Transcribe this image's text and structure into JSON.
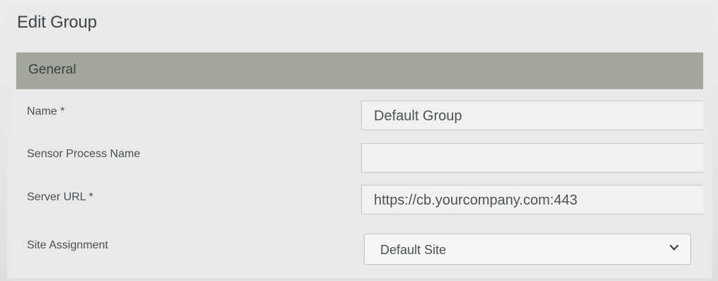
{
  "window": {
    "title": "Edit Group"
  },
  "section": {
    "title": "General"
  },
  "fields": {
    "name": {
      "label": "Name *",
      "value": "Default Group"
    },
    "sensor_process_name": {
      "label": "Sensor Process Name",
      "value": ""
    },
    "server_url": {
      "label": "Server URL *",
      "value": "https://cb.yourcompany.com:443"
    },
    "site_assignment": {
      "label": "Site Assignment",
      "value": "Default Site"
    }
  },
  "icons": {
    "dropdown": "chevron-down-icon"
  },
  "colors": {
    "section_header": "#a3a69b",
    "background": "#e9e9e9"
  }
}
